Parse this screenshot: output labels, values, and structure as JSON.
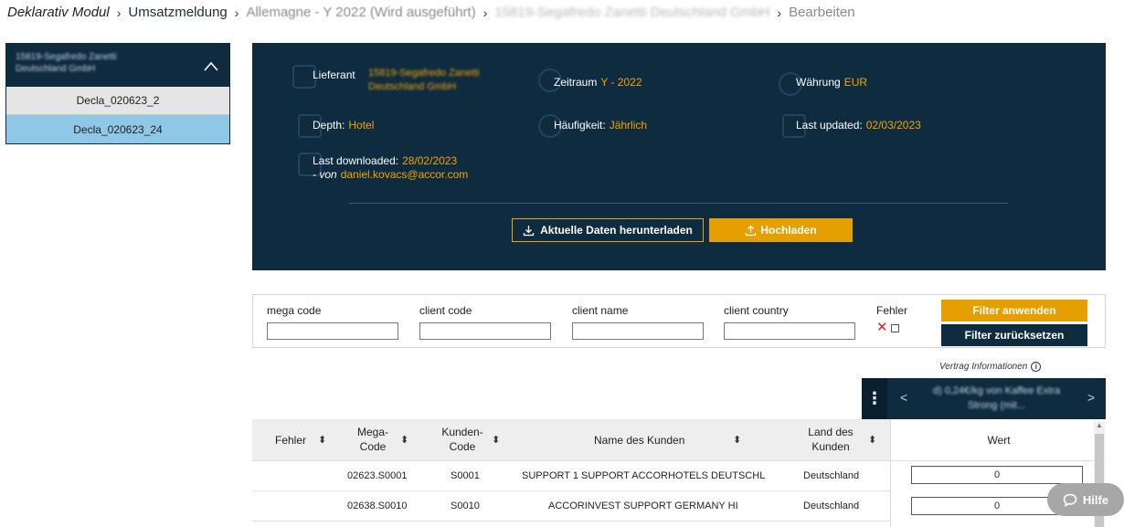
{
  "breadcrumb": {
    "root": "Deklarativ Modul",
    "section": "Umsatzmeldung",
    "declaration": "Allemagne - Y 2022 (Wird ausgeführt)",
    "supplier": "15819-Segafredo Zanetti Deutschland GmbH",
    "current": "Bearbeiten",
    "separator": "›"
  },
  "sidebar": {
    "supplier": "15819-Segafredo Zanetti Deutschland GmbH",
    "items": [
      {
        "label": "Decla_020623_2"
      },
      {
        "label": "Decla_020623_24"
      }
    ]
  },
  "info": {
    "supplier_label": "Lieferant",
    "supplier_value": "15819-Segafredo Zanetti Deutschland GmbH",
    "period_label": "Zeitraum",
    "period_value": "Y - 2022",
    "currency_label": "Währung",
    "currency_value": "EUR",
    "depth_label": "Depth:",
    "depth_value": "Hotel",
    "frequency_label": "Häufigkeit:",
    "frequency_value": "Jährlich",
    "updated_label": "Last updated:",
    "updated_value": "02/03/2023",
    "downloaded_label": "Last downloaded:",
    "downloaded_value": "28/02/2023",
    "by_label": "- von",
    "by_value": "daniel.kovacs@accor.com",
    "download_button": "Aktuelle Daten herunterladen",
    "upload_button": "Hochladen"
  },
  "filters": {
    "mega_code": "mega code",
    "client_code": "client code",
    "client_name": "client name",
    "client_country": "client country",
    "error": "Fehler",
    "apply": "Filter anwenden",
    "reset": "Filter zurücksetzen"
  },
  "contract": {
    "label": "Vertrag Informationen",
    "product": "d) 0,24€/kg von Kaffee Extra Strong (mit...",
    "prev": "<",
    "next": ">"
  },
  "table": {
    "headers": {
      "error": "Fehler",
      "mega_code": "Mega-\nCode",
      "mega_code_l1": "Mega-",
      "mega_code_l2": "Code",
      "client_code_l1": "Kunden-",
      "client_code_l2": "Code",
      "client_name": "Name des Kunden",
      "country_l1": "Land des",
      "country_l2": "Kunden",
      "value": "Wert"
    },
    "rows": [
      {
        "mega_code": "02623.S0001",
        "client_code": "S0001",
        "name": "SUPPORT 1 SUPPORT ACCORHOTELS DEUTSCHL",
        "country": "Deutschland",
        "value": "0"
      },
      {
        "mega_code": "02638.S0010",
        "client_code": "S0010",
        "name": "ACCORINVEST SUPPORT GERMANY HI",
        "country": "Deutschland",
        "value": "0"
      }
    ]
  },
  "help": {
    "label": "Hilfe"
  },
  "colors": {
    "navy": "#0f2b40",
    "accent": "#f0a500",
    "selected": "#8fc7e6"
  }
}
